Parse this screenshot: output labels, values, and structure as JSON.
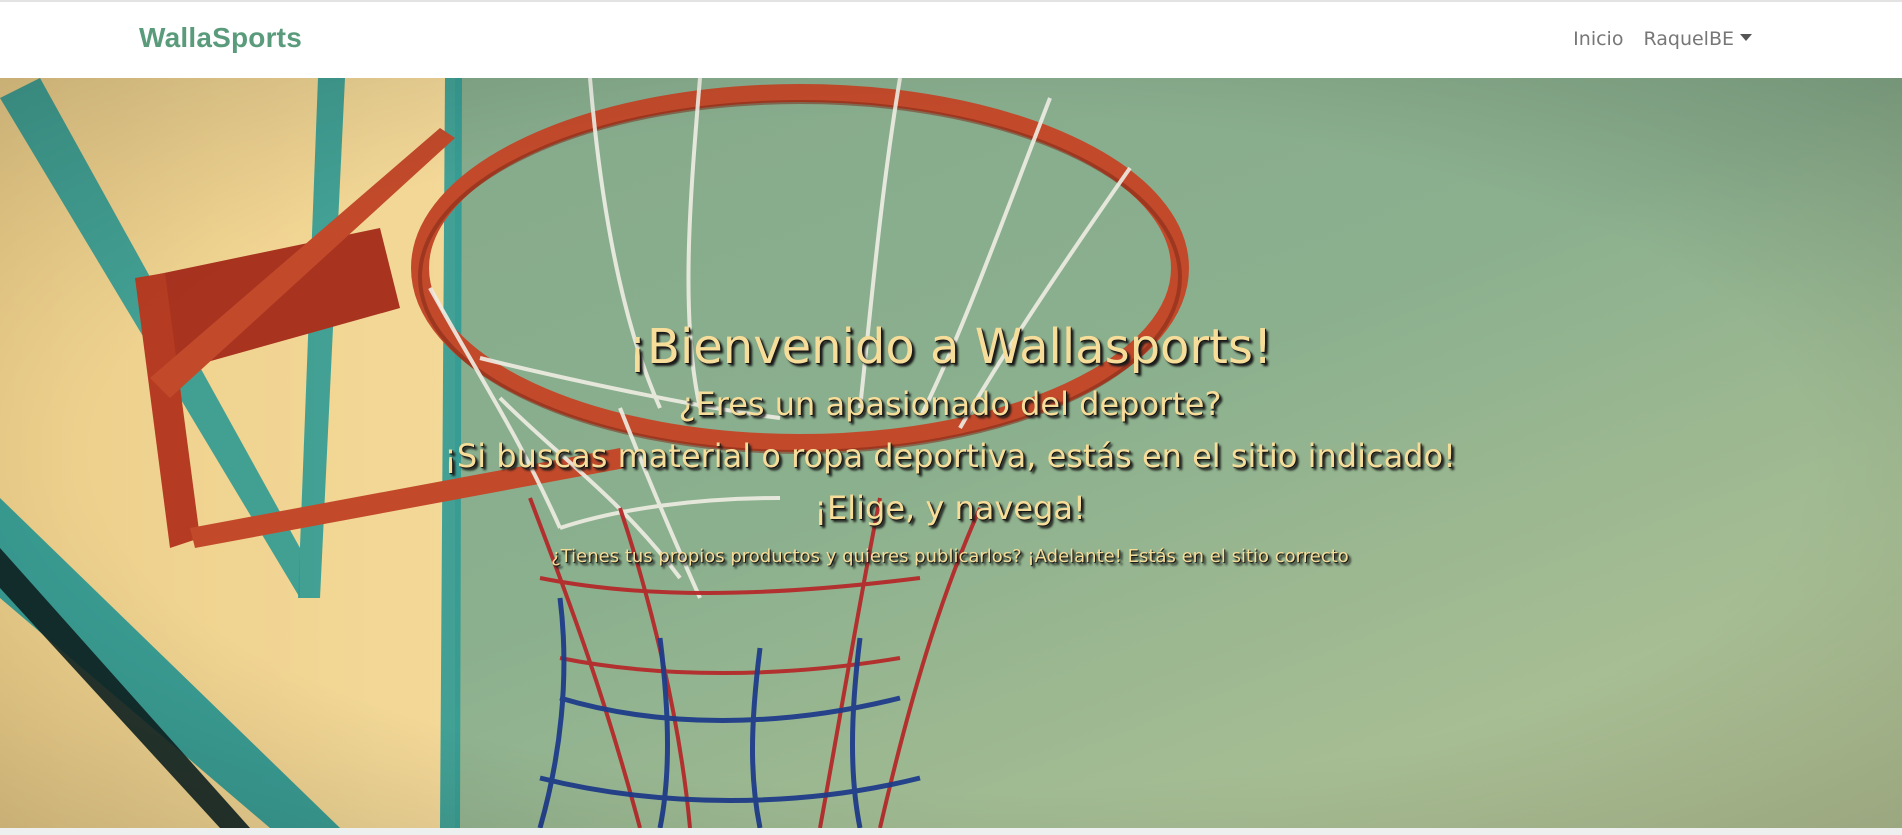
{
  "navbar": {
    "brand": "WallaSports",
    "links": [
      "Inicio"
    ],
    "user_menu": "RaquelBE"
  },
  "hero": {
    "title": "¡Bienvenido a Wallasports!",
    "line1": "¿Eres un apasionado del deporte?",
    "line2": "¡Si buscas material o ropa deportiva, estás en el sitio indicado!",
    "line3": "¡Elige, y navega!",
    "subtitle": "¿Tienes tus propios productos y quieres publicarlos? ¡Adelante! Estás en el sitio correcto"
  },
  "colors": {
    "brand": "#5a9b7b",
    "hero_text": "#f7dd9a",
    "rim": "#c24a2b",
    "backboard": "#f4d98e",
    "teal_stripe": "#2f9a93"
  },
  "icons": {
    "dropdown": "caret-down-icon"
  }
}
